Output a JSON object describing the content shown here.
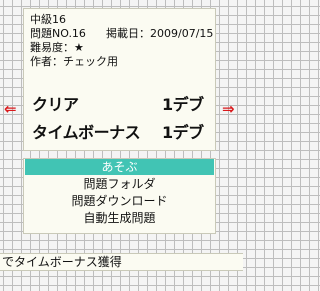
{
  "puzzle": {
    "level": "中級16",
    "number": "問題NO.16",
    "posted": "掲載日：2009/07/15",
    "difficulty": "難易度：★",
    "author": "作者：チェック用"
  },
  "stats": {
    "clear_label": "クリア",
    "clear_value": "1デブ",
    "timebonus_label": "タイムボーナス",
    "timebonus_value": "1デブ"
  },
  "nav": {
    "prev_icon": "arrow-left-icon",
    "next_icon": "arrow-right-icon",
    "prev_glyph": "⇐",
    "next_glyph": "⇒",
    "arrow_color": "#d9191c"
  },
  "menu": {
    "items": [
      {
        "label": "あそぶ",
        "selected": true
      },
      {
        "label": "問題フォルダ",
        "selected": false
      },
      {
        "label": "問題ダウンロード",
        "selected": false
      },
      {
        "label": "自動生成問題",
        "selected": false
      }
    ],
    "accent": "#41c4b4"
  },
  "status": {
    "text": "でタイムボーナス獲得"
  }
}
